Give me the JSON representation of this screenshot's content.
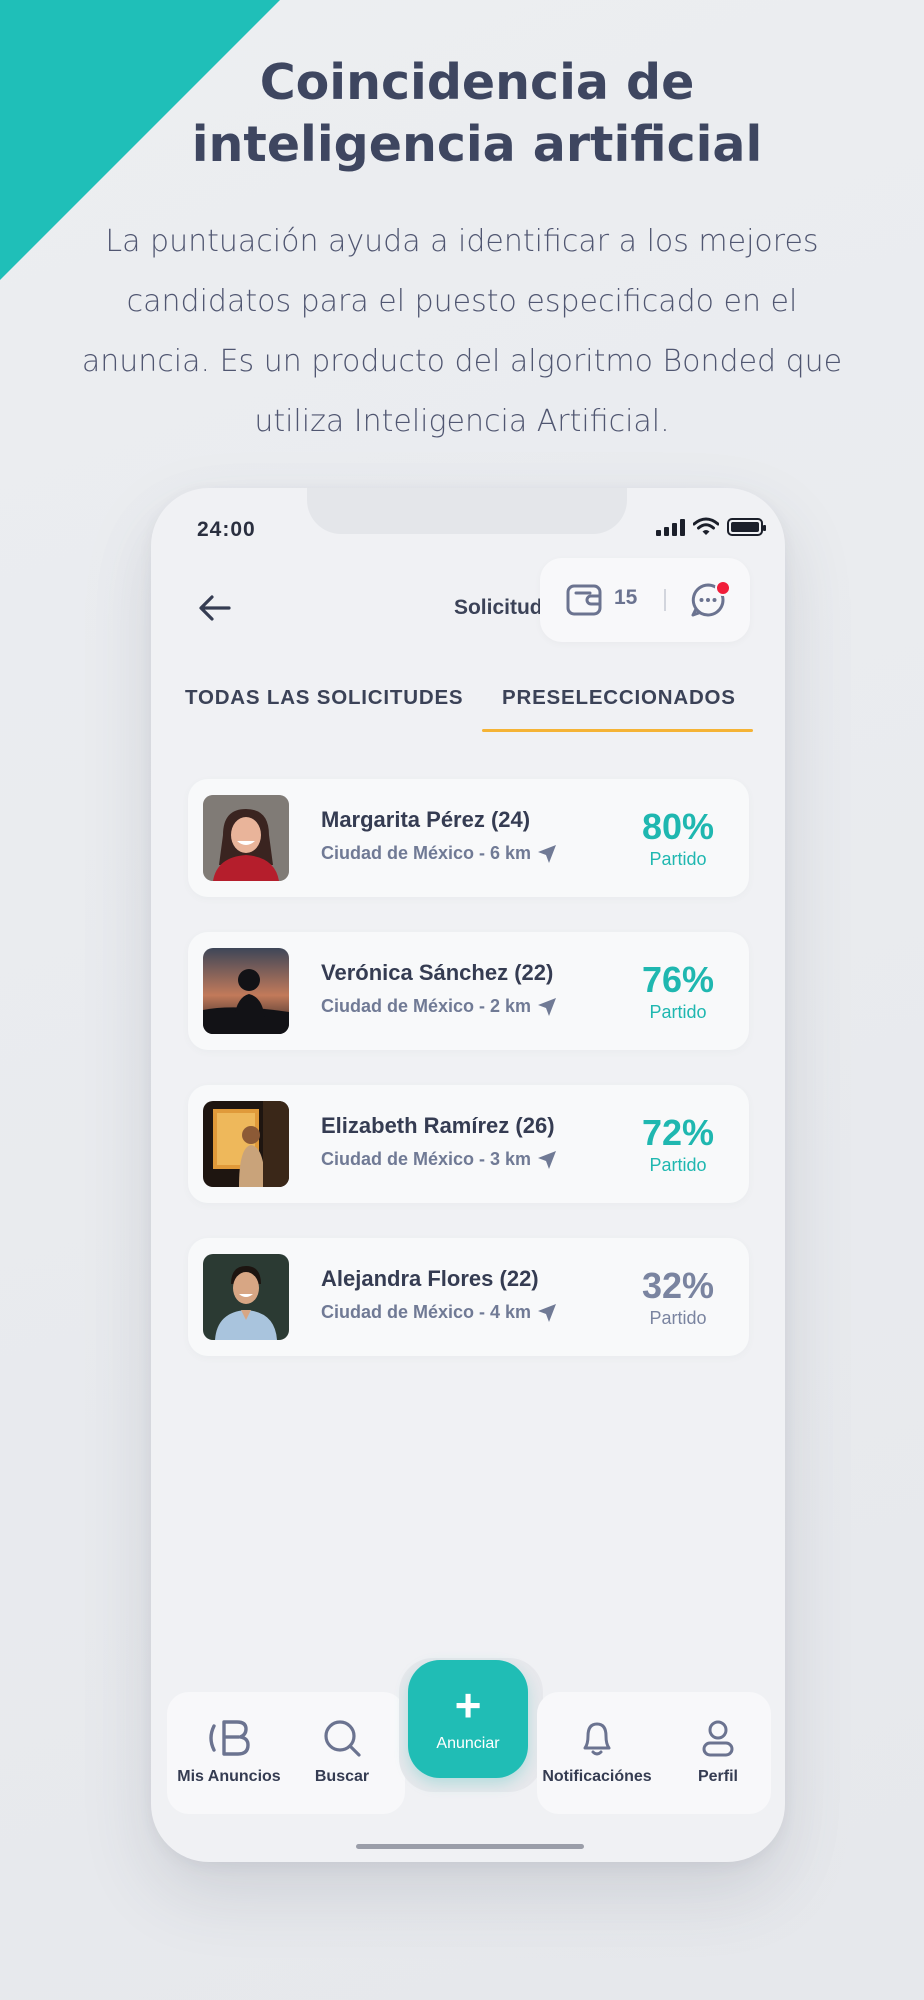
{
  "promo": {
    "title_line1": "Coincidencia de",
    "title_line2": "inteligencia artificial",
    "subtitle": "La puntuación ayuda a identificar a los mejores candidatos para el puesto especificado en el anuncia. Es un producto del algoritmo Bonded que utiliza Inteligencia Artificial."
  },
  "status": {
    "time": "24:00"
  },
  "header": {
    "title": "Solicitudes",
    "credits": "15"
  },
  "tabs": [
    {
      "label": "TODAS LAS SOLICITUDES",
      "active": false
    },
    {
      "label": "PRESELECCIONADOS",
      "active": true
    }
  ],
  "candidates": [
    {
      "name": "Margarita Pérez (24)",
      "location": "Ciudad de México - 6 km",
      "match": "80%",
      "match_label": "Partido",
      "color": "#1fb7b0"
    },
    {
      "name": "Verónica Sánchez (22)",
      "location": "Ciudad de México - 2 km",
      "match": "76%",
      "match_label": "Partido",
      "color": "#1fb7b0"
    },
    {
      "name": "Elizabeth Ramírez (26)",
      "location": "Ciudad de México - 3 km",
      "match": "72%",
      "match_label": "Partido",
      "color": "#1fb7b0"
    },
    {
      "name": "Alejandra Flores  (22)",
      "location": "Ciudad de México - 4 km",
      "match": "32%",
      "match_label": "Partido",
      "color": "#7a84a0"
    }
  ],
  "nav": {
    "mis_anuncios": "Mis Anuncios",
    "buscar": "Buscar",
    "anunciar": "Anunciar",
    "notificaciones": "Notificaciónes",
    "perfil": "Perfil"
  },
  "colors": {
    "accent": "#20bdb5",
    "tab_underline": "#f5b335",
    "notification_dot": "#f11d3a"
  }
}
